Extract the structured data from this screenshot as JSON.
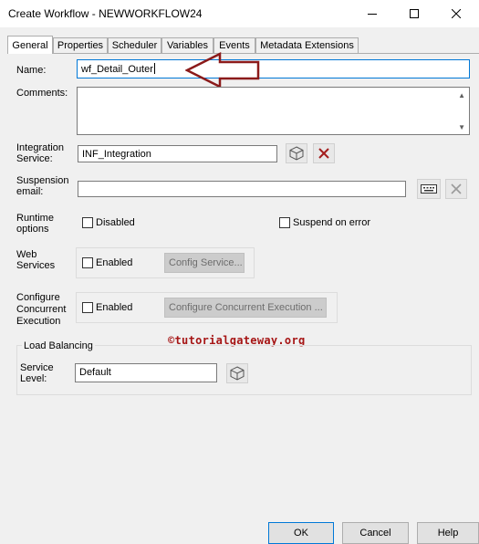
{
  "window": {
    "title": "Create Workflow - NEWWORKFLOW24"
  },
  "tabs": [
    "General",
    "Properties",
    "Scheduler",
    "Variables",
    "Events",
    "Metadata Extensions"
  ],
  "active_tab": "General",
  "form": {
    "name_label": "Name:",
    "name_value": "wf_Detail_Outer",
    "comments_label": "Comments:",
    "comments_value": "",
    "integration_label_1": "Integration",
    "integration_label_2": "Service:",
    "integration_value": "INF_Integration",
    "suspension_label_1": "Suspension",
    "suspension_label_2": "email:",
    "suspension_value": "",
    "runtime_label_1": "Runtime",
    "runtime_label_2": "options",
    "disabled_label": "Disabled",
    "disabled_checked": false,
    "suspend_on_error_label": "Suspend on error",
    "suspend_on_error_checked": false,
    "web_label_1": "Web",
    "web_label_2": "Services",
    "web_enabled_label": "Enabled",
    "web_enabled_checked": false,
    "config_service_button": "Config Service...",
    "concurrent_label_1": "Configure",
    "concurrent_label_2": "Concurrent",
    "concurrent_label_3": "Execution",
    "concurrent_enabled_label": "Enabled",
    "concurrent_enabled_checked": false,
    "configure_concurrent_button": "Configure Concurrent Execution ...",
    "load_balancing_label": "Load Balancing",
    "service_level_label_1": "Service",
    "service_level_label_2": "Level:",
    "service_level_value": "Default"
  },
  "watermark": "©tutorialgateway.org",
  "footer": {
    "ok": "OK",
    "cancel": "Cancel",
    "help": "Help"
  },
  "colors": {
    "accent": "#0078d7",
    "arrow": "#8b1a1a",
    "watermark": "#a61515",
    "delete_x": "#a41e1e"
  }
}
